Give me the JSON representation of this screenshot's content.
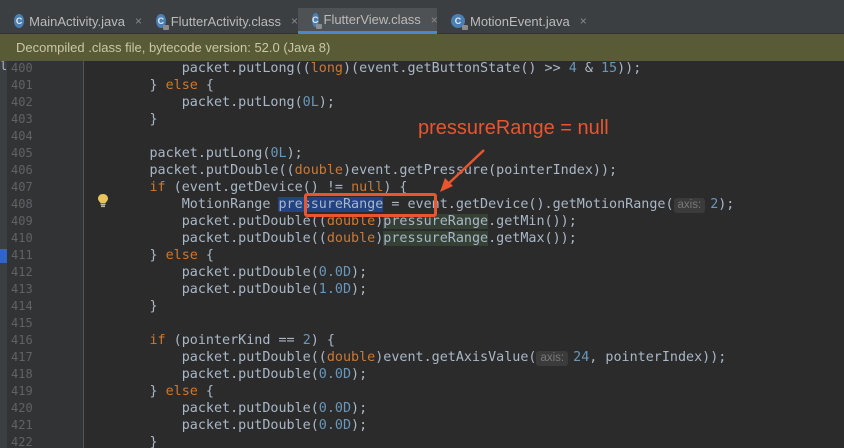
{
  "tabs": [
    {
      "label": "MainActivity.java",
      "icon": "java-class-icon",
      "active": false,
      "locked": false
    },
    {
      "label": "FlutterActivity.class",
      "icon": "class-file-icon",
      "active": false,
      "locked": true
    },
    {
      "label": "FlutterView.class",
      "icon": "class-file-icon",
      "active": true,
      "locked": true
    },
    {
      "label": "MotionEvent.java",
      "icon": "java-class-icon",
      "active": false,
      "locked": true
    }
  ],
  "tab_close_glyph": "×",
  "tab_icon_letter": "C",
  "info_bar": "Decompiled .class file, bytecode version: 52.0 (Java 8)",
  "left_fragments": [
    "le",
    "s/"
  ],
  "line_numbers": [
    "400",
    "401",
    "402",
    "403",
    "404",
    "405",
    "406",
    "407",
    "408",
    "409",
    "410",
    "411",
    "412",
    "413",
    "414",
    "415",
    "416",
    "417",
    "418",
    "419",
    "420",
    "421",
    "422"
  ],
  "code": {
    "l400": {
      "a": "            packet.putLong((",
      "kw": "long",
      "b": ")(event.getButtonState() >> ",
      "n1": "4",
      "c": " & ",
      "n2": "15",
      "d": "));"
    },
    "l401": {
      "a": "        } ",
      "kw": "else",
      "b": " {"
    },
    "l402": {
      "a": "            packet.putLong(",
      "n": "0L",
      "b": ");"
    },
    "l403": {
      "a": "        }"
    },
    "l405": {
      "a": "        packet.putLong(",
      "n": "0L",
      "b": ");"
    },
    "l406": {
      "a": "        packet.putDouble((",
      "kw": "double",
      "b": ")event.getPressure(pointerIndex));"
    },
    "l407": {
      "kw1": "        if",
      "a": " (event.getDevice() != ",
      "kw2": "null",
      "b": ") {"
    },
    "l408": {
      "a": "            MotionRange ",
      "var": "pressureRange",
      "b": " = event.getDevice().getMotionRange(",
      "hint": "axis:",
      "n": "2",
      "c": ");"
    },
    "l409": {
      "a": "            packet.putDouble((",
      "kw": "double",
      "b": ")",
      "var": "pressureRange",
      "c": ".getMin());"
    },
    "l410": {
      "a": "            packet.putDouble((",
      "kw": "double",
      "b": ")",
      "var": "pressureRange",
      "c": ".getMax());"
    },
    "l411": {
      "a": "        } ",
      "kw": "else",
      "b": " {"
    },
    "l412": {
      "a": "            packet.putDouble(",
      "n": "0.0D",
      "b": ");"
    },
    "l413": {
      "a": "            packet.putDouble(",
      "n": "1.0D",
      "b": ");"
    },
    "l414": {
      "a": "        }"
    },
    "l416": {
      "kw": "        if",
      "a": " (pointerKind == ",
      "n": "2",
      "b": ") {"
    },
    "l417": {
      "a": "            packet.putDouble((",
      "kw": "double",
      "b": ")event.getAxisValue(",
      "hint": "axis:",
      "n": "24",
      "c": ", pointerIndex));"
    },
    "l418": {
      "a": "            packet.putDouble(",
      "n": "0.0D",
      "b": ");"
    },
    "l419": {
      "a": "        } ",
      "kw": "else",
      "b": " {"
    },
    "l420": {
      "a": "            packet.putDouble(",
      "n": "0.0D",
      "b": ");"
    },
    "l421": {
      "a": "            packet.putDouble(",
      "n": "0.0D",
      "b": ");"
    },
    "l422": {
      "a": "        }"
    }
  },
  "annotation": "pressureRange = null",
  "colors": {
    "keyword": "#cc7832",
    "number": "#6897bb",
    "text": "#a9b7c6",
    "annotation": "#e8552f",
    "info_bar": "#595b37",
    "active_tab_underline": "#4a88c7"
  }
}
